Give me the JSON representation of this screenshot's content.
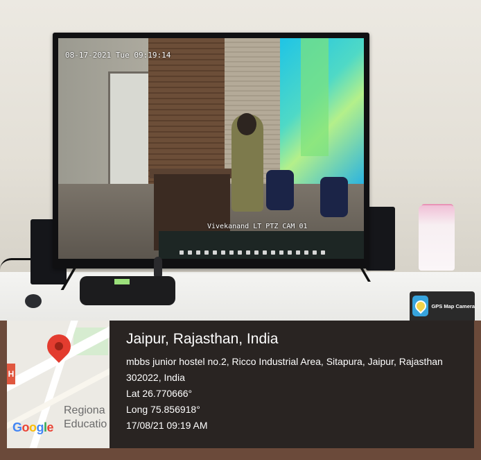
{
  "camera_feed": {
    "timestamp": "08-17-2021 Tue 09:19:14",
    "camera_name": "Vivekanand LT PTZ CAM 01"
  },
  "gps_badge": {
    "label": "GPS Map Camera",
    "icon": "gps-map-camera-icon"
  },
  "map": {
    "place_label_line1": "Regiona",
    "place_label_line2": "Educatio",
    "google_letters": [
      "G",
      "o",
      "o",
      "g",
      "l",
      "e"
    ],
    "pin_icon": "map-pin-icon",
    "pin_color": "#e33c2f"
  },
  "location": {
    "title": "Jaipur, Rajasthan, India",
    "address_line1": "mbbs junior hostel no.2, Ricco Industrial Area, Sitapura, Jaipur, Rajasthan",
    "address_line2": "302022, India",
    "latitude": "Lat 26.770666°",
    "longitude": "Long 75.856918°",
    "datetime": "17/08/21 09:19 AM"
  }
}
